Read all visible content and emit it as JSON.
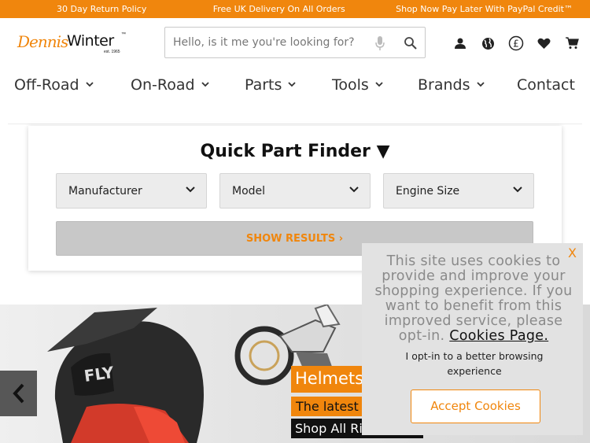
{
  "topbar": {
    "left": "30 Day Return Policy",
    "middle": "Free UK Delivery On All Orders",
    "right": "Shop Now Pay Later With PayPal Credit™"
  },
  "logo": {
    "script": "Dennis",
    "bold": "Winter",
    "tm": "™",
    "est": "est. 1965"
  },
  "search": {
    "placeholder": "Hello, is it me you're looking for?"
  },
  "header_icons": [
    "account-icon",
    "globe-icon",
    "currency-icon",
    "heart-icon",
    "cart-icon"
  ],
  "currency_symbol": "£",
  "nav": {
    "items": [
      {
        "label": "Off-Road",
        "has_dropdown": true
      },
      {
        "label": "On-Road",
        "has_dropdown": true
      },
      {
        "label": "Parts",
        "has_dropdown": true
      },
      {
        "label": "Tools",
        "has_dropdown": true
      },
      {
        "label": "Brands",
        "has_dropdown": true
      },
      {
        "label": "Contact",
        "has_dropdown": false
      }
    ]
  },
  "finder": {
    "title": "Quick Part Finder ▼",
    "selects": [
      "Manufacturer",
      "Model",
      "Engine Size"
    ],
    "button": "SHOW RESULTS ›"
  },
  "banner": {
    "tag1": "Helmets",
    "tag2": "The latest",
    "tag3": "Shop All Ri",
    "helmet_brand": "FLY"
  },
  "cookie": {
    "close": "X",
    "message": "This site uses cookies to provide and improve your shopping experience. If you want to benefit from this improved service, please opt-in.",
    "link": "Cookies Page.",
    "optin": "I opt-in to a better browsing experience",
    "accept": "Accept Cookies"
  },
  "colors": {
    "accent": "#f0860d",
    "text": "#333333",
    "grey_select": "#ececec"
  }
}
